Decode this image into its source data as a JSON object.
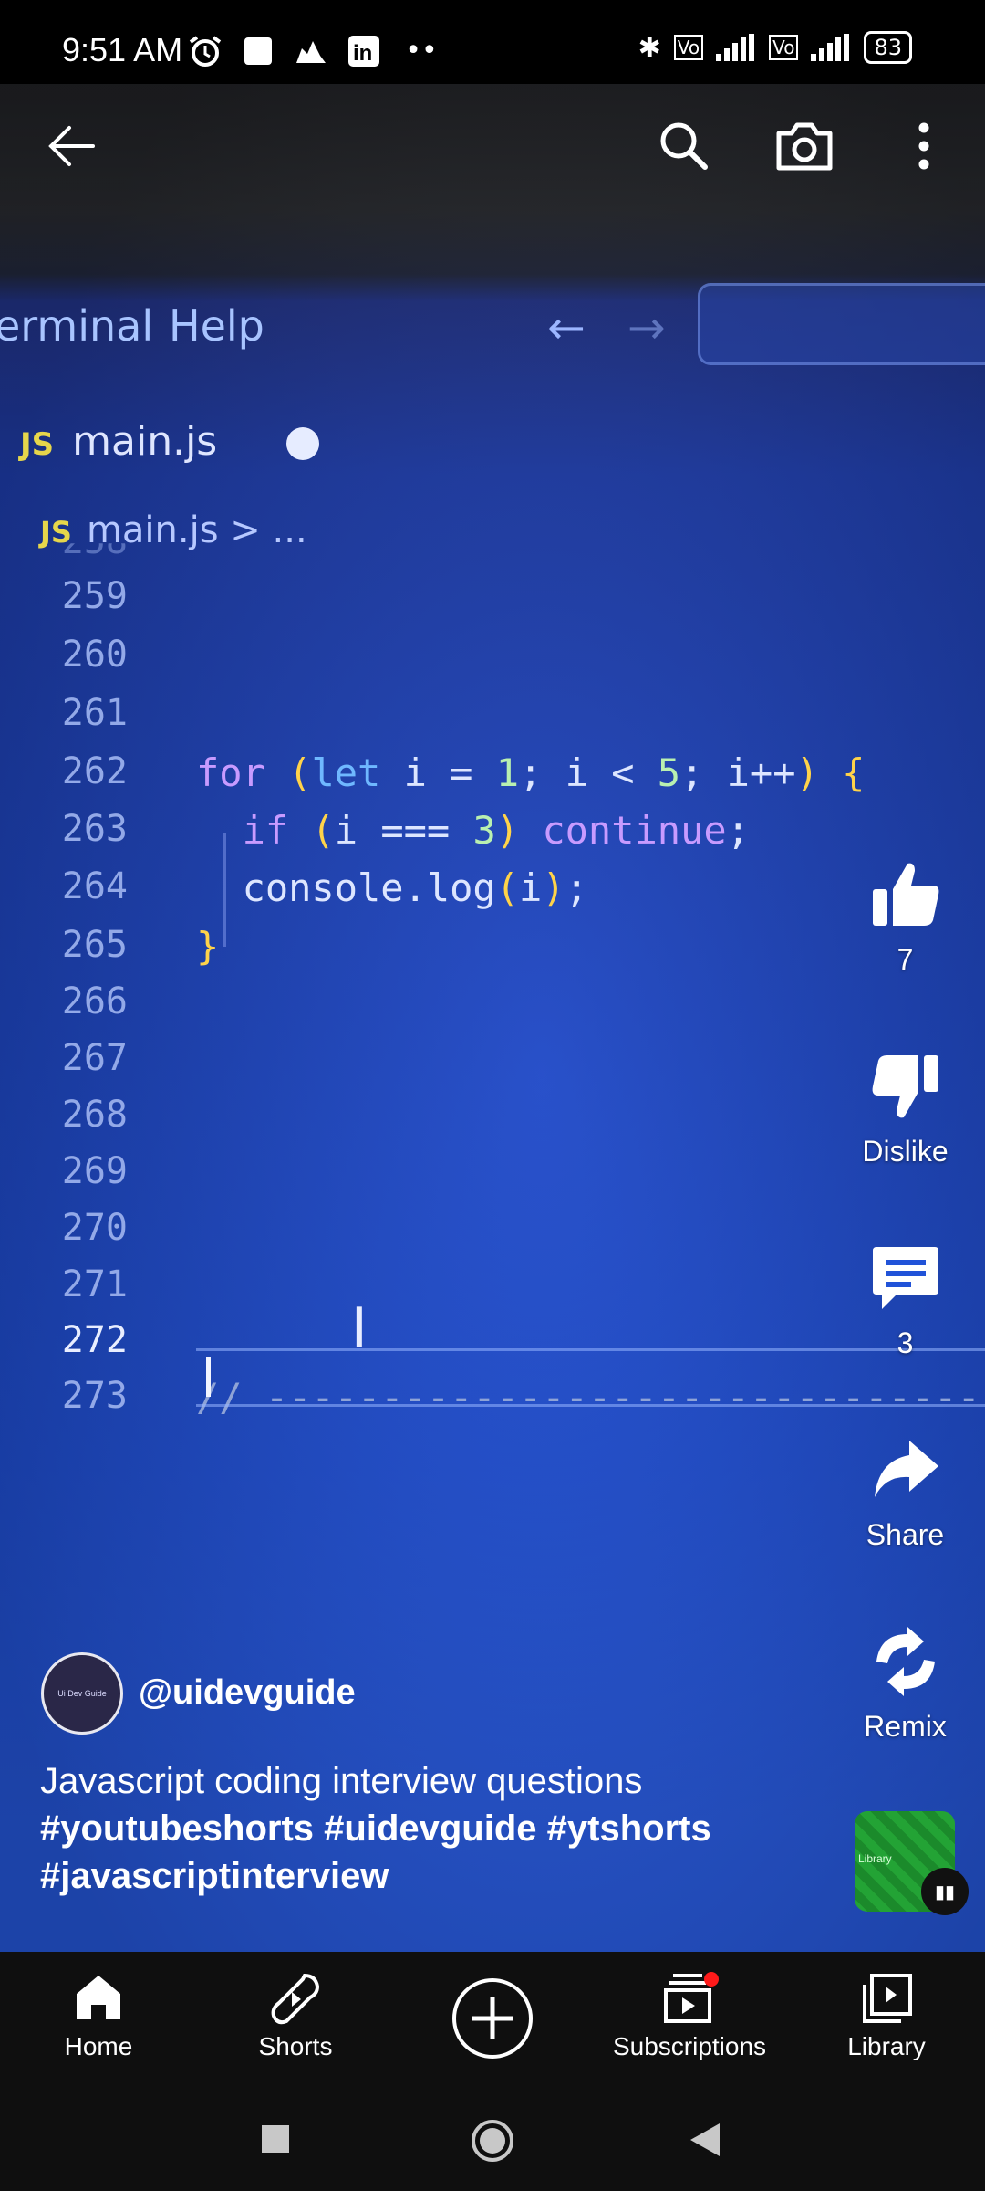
{
  "status_bar": {
    "time": "9:51 AM",
    "battery": "83"
  },
  "video": {
    "menu": [
      "erminal",
      "Help"
    ],
    "tab_label": "main.js",
    "tab_badge": "JS",
    "breadcrumb": "main.js > ...",
    "code_lines": [
      {
        "num": "258",
        "text": ""
      },
      {
        "num": "259",
        "text": ""
      },
      {
        "num": "260",
        "text": ""
      },
      {
        "num": "261",
        "text": ""
      },
      {
        "num": "262",
        "text": "for (let i = 1; i < 5; i++) {"
      },
      {
        "num": "263",
        "text": "  if (i === 3) continue;"
      },
      {
        "num": "264",
        "text": "  console.log(i);"
      },
      {
        "num": "265",
        "text": "}"
      },
      {
        "num": "266",
        "text": ""
      },
      {
        "num": "267",
        "text": ""
      },
      {
        "num": "268",
        "text": ""
      },
      {
        "num": "269",
        "text": ""
      },
      {
        "num": "270",
        "text": ""
      },
      {
        "num": "271",
        "text": ""
      },
      {
        "num": "272",
        "text": ""
      },
      {
        "num": "273",
        "text": "// ------------------------------------------------"
      }
    ]
  },
  "actions": {
    "like_count": "7",
    "dislike_label": "Dislike",
    "comment_count": "3",
    "share_label": "Share",
    "remix_label": "Remix"
  },
  "channel": {
    "avatar_text": "Ui Dev Guide",
    "handle": "@uidevguide"
  },
  "description": {
    "title": "Javascript coding interview questions",
    "hashtags": "#youtubeshorts #uidevguide #ytshorts #javascriptinterview"
  },
  "music": {
    "label": "Library"
  },
  "nav": {
    "home": "Home",
    "shorts": "Shorts",
    "subscriptions": "Subscriptions",
    "library": "Library"
  }
}
